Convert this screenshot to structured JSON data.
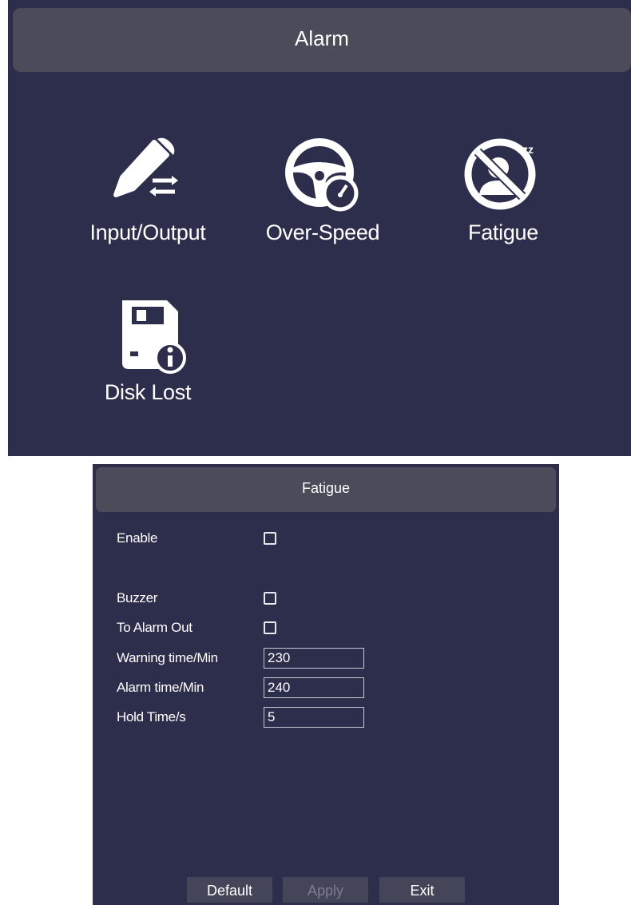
{
  "alarm": {
    "title": "Alarm",
    "items": [
      {
        "label": "Input/Output",
        "icon": "pencil-arrows-icon"
      },
      {
        "label": "Over-Speed",
        "icon": "steering-speedometer-icon"
      },
      {
        "label": "Fatigue",
        "icon": "no-sleep-person-icon"
      },
      {
        "label": "Disk Lost",
        "icon": "floppy-info-icon"
      }
    ]
  },
  "fatigue": {
    "title": "Fatigue",
    "enable_label": "Enable",
    "buzzer_label": "Buzzer",
    "alarm_out_label": "To Alarm Out",
    "warning_time_label": "Warning time/Min",
    "warning_time_value": "230",
    "alarm_time_label": "Alarm time/Min",
    "alarm_time_value": "240",
    "hold_time_label": "Hold Time/s",
    "hold_time_value": "5",
    "enable_checked": false,
    "buzzer_checked": false,
    "alarm_out_checked": false,
    "buttons": {
      "default": "Default",
      "apply": "Apply",
      "exit": "Exit"
    }
  },
  "colors": {
    "panel_bg": "#2d2d4c",
    "title_bar": "#4b4b59",
    "text": "#ffffff",
    "disabled_text": "#7c7c92"
  }
}
